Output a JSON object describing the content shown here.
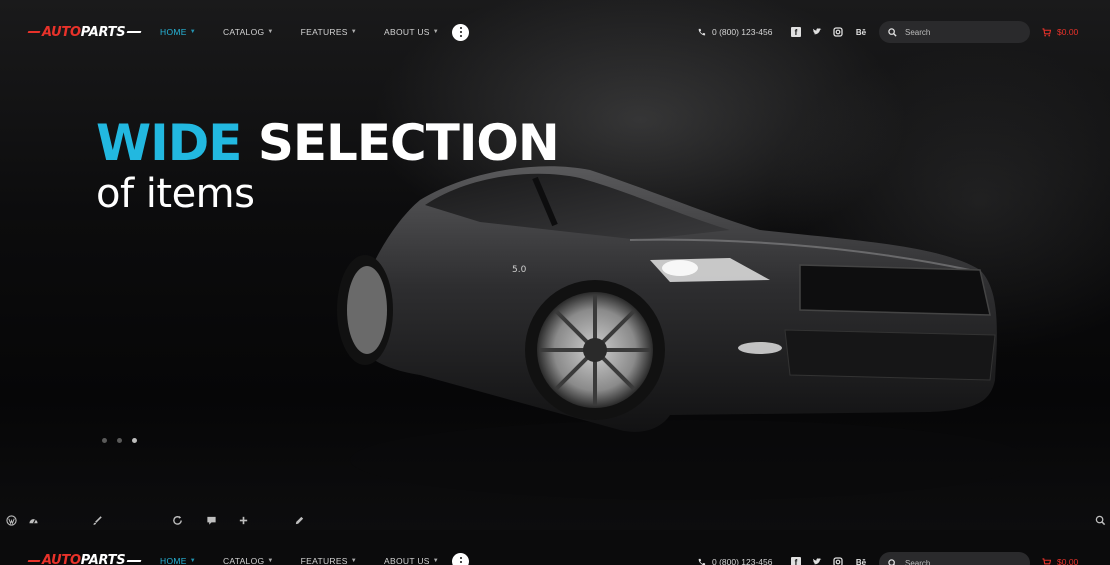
{
  "header": {
    "logo": {
      "part1": "AUTO",
      "part2": "PARTS"
    },
    "nav": [
      {
        "label": "HOME",
        "active": true
      },
      {
        "label": "CATALOG",
        "active": false
      },
      {
        "label": "FEATURES",
        "active": false
      },
      {
        "label": "ABOUT US",
        "active": false
      }
    ],
    "more_icon": "more-vertical-icon",
    "phone": "0 (800) 123-456",
    "social": [
      "facebook-icon",
      "twitter-icon",
      "instagram-icon",
      "behance-icon"
    ],
    "search": {
      "placeholder": "Search"
    },
    "cart_total": "$0.00"
  },
  "hero": {
    "headline_accent": "WIDE",
    "headline_rest": "SELECTION",
    "subheadline": "of items",
    "slides": 3,
    "active_slide": 3
  },
  "toolbar": {
    "icons": [
      "wordpress-icon",
      "dashboard-icon",
      "brush-icon",
      "refresh-icon",
      "comment-icon",
      "plus-icon",
      "edit-icon",
      "search-icon"
    ]
  },
  "colors": {
    "accent": "#22b8e0",
    "brand_red": "#e8322a",
    "nav_active": "#27b5d9"
  }
}
